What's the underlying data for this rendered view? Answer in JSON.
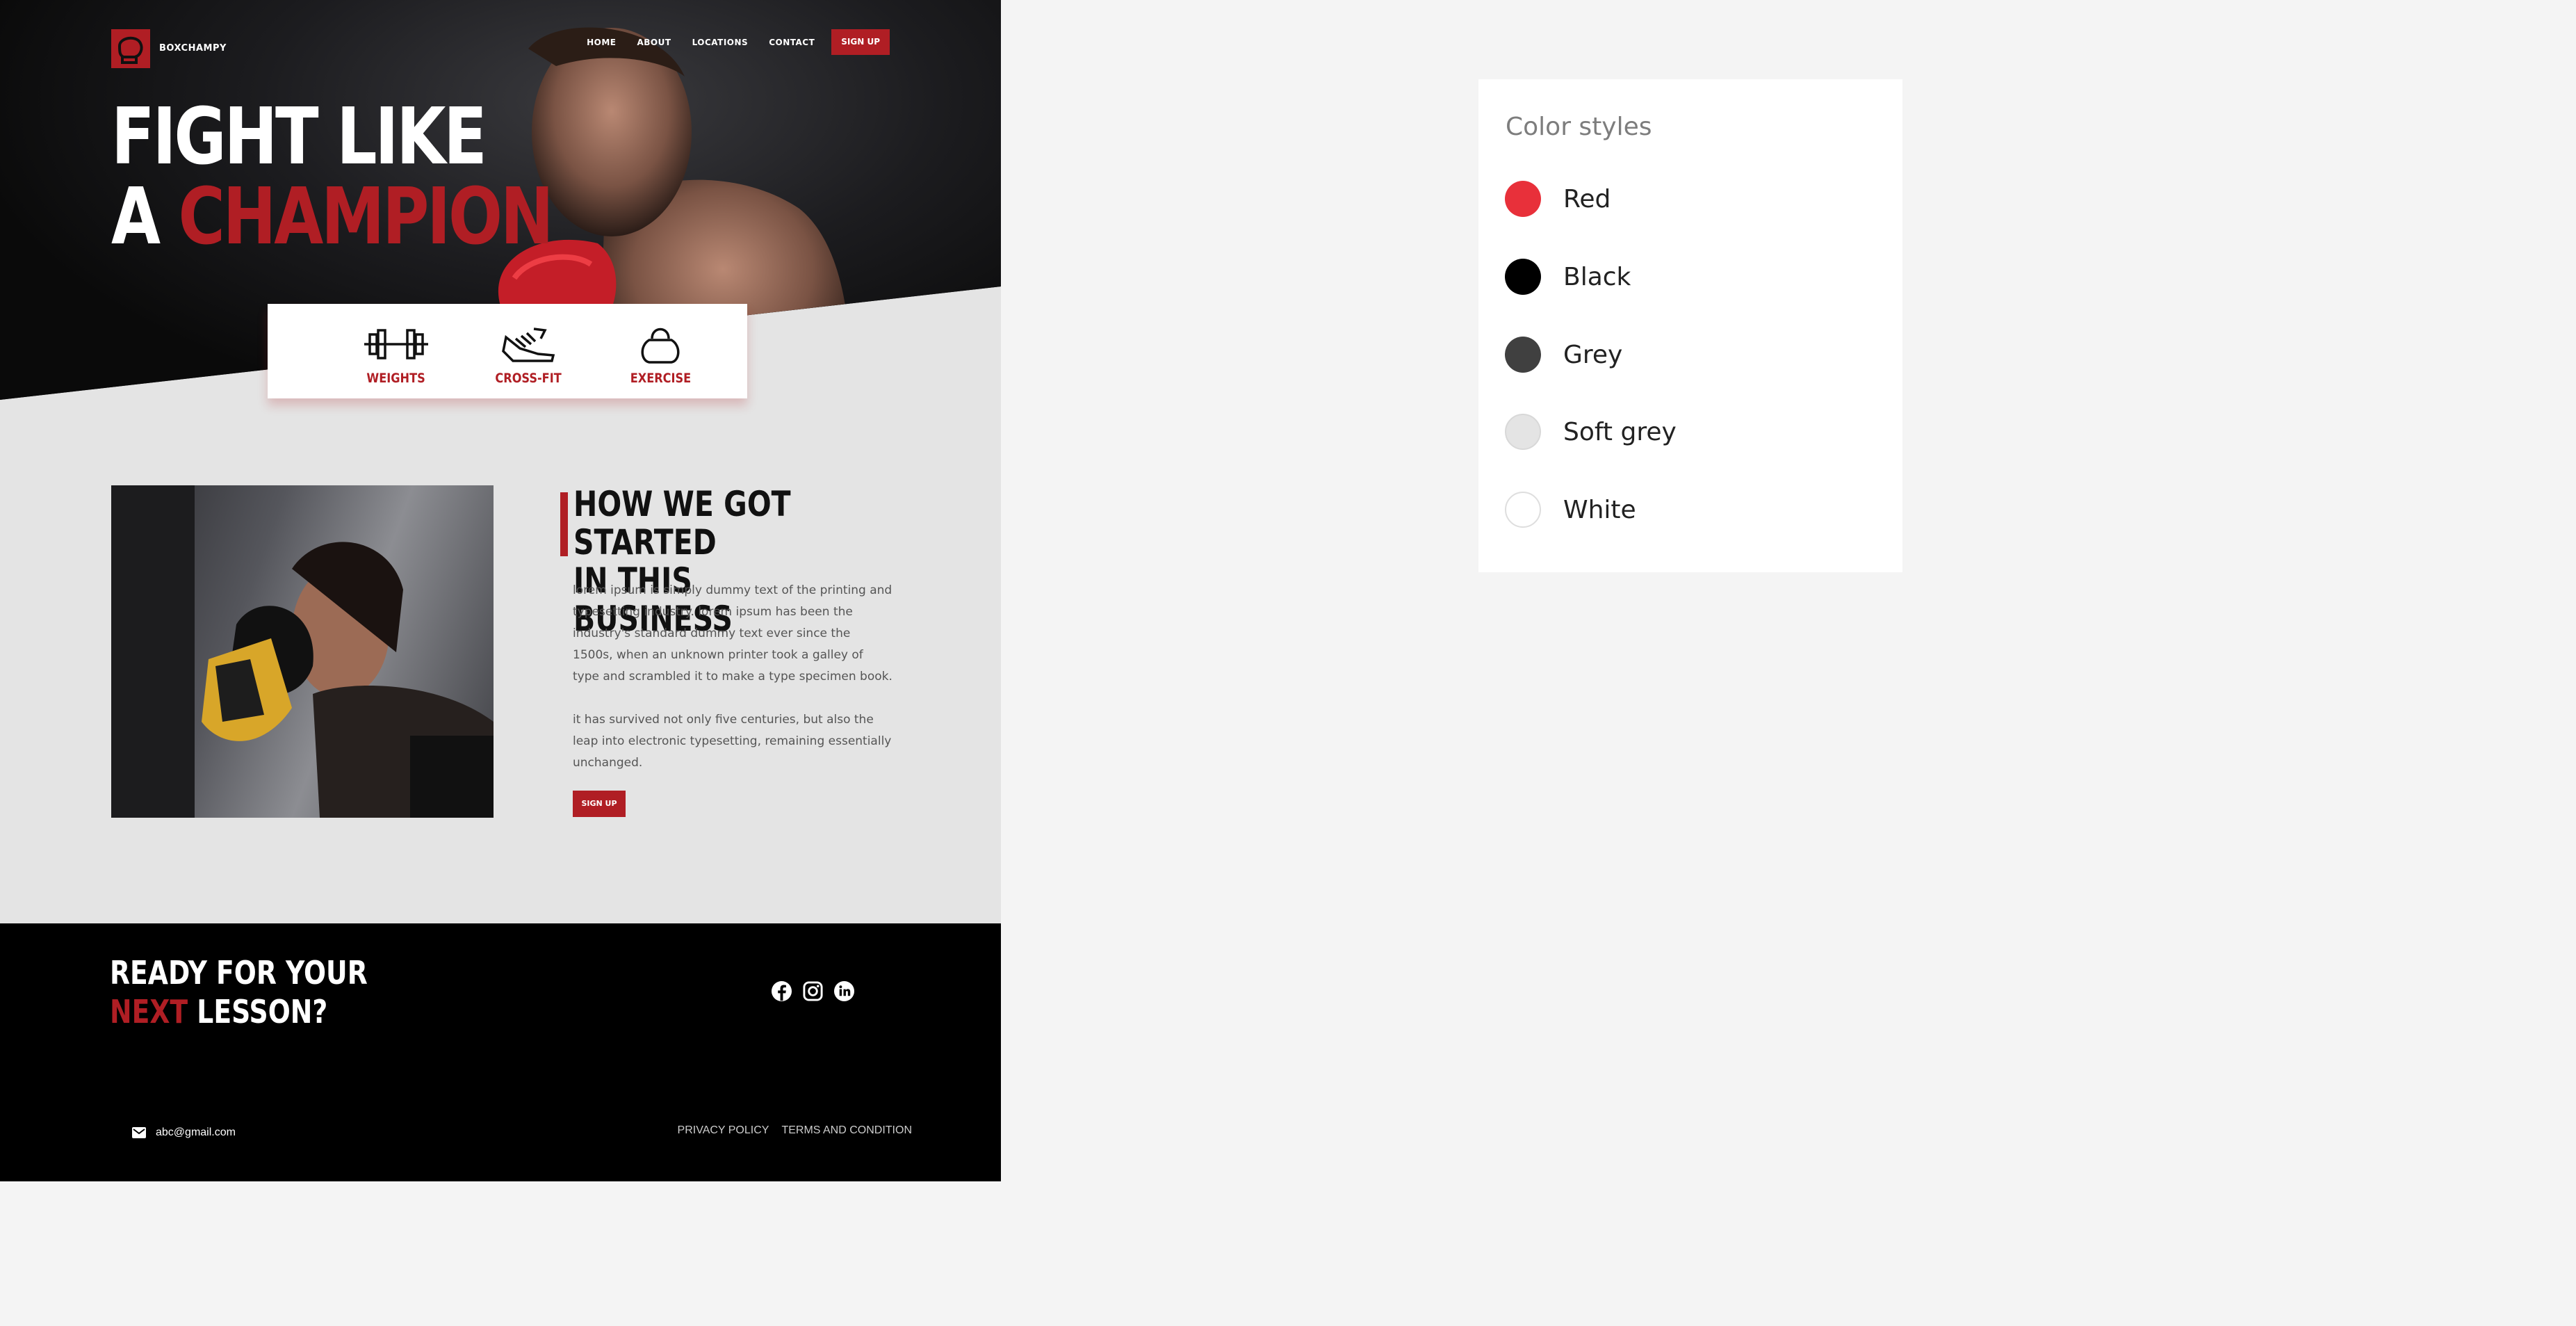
{
  "colors": {
    "red": "#b01e24",
    "black": "#000000",
    "bg_grey": "#e4e4e4",
    "page_bg": "#f4f4f4"
  },
  "nav": {
    "brand": "BOXCHAMPY",
    "logo_icon": "boxing-glove-icon",
    "links": [
      "HOME",
      "ABOUT",
      "LOCATIONS",
      "CONTACT"
    ],
    "signup": "SIGN UP"
  },
  "hero": {
    "line1": "FIGHT LIKE",
    "line2_prefix": "A ",
    "line2_highlight": "CHAMPION"
  },
  "features": [
    {
      "label": "WEIGHTS",
      "icon": "barbell-icon"
    },
    {
      "label": "CROSS-FIT",
      "icon": "sneaker-icon"
    },
    {
      "label": "EXERCISE",
      "icon": "kettlebell-icon"
    }
  ],
  "about": {
    "title_line1": "HOW WE GOT STARTED",
    "title_line2": "IN THIS BUSINESS",
    "paragraph1": "lorem ipsum is simply dummy text of the printing and typesetting industry. lorem ipsum has been the industry's standard dummy text ever since the 1500s, when an unknown printer took a galley of type and scrambled it to make a type specimen book.",
    "paragraph2": "it has survived not only five centuries, but also the leap into electronic typesetting, remaining essentially unchanged.",
    "button": "SIGN UP"
  },
  "footer": {
    "cta_line1": "READY FOR YOUR",
    "cta_highlight": "NEXT",
    "cta_rest": " LESSON?",
    "socials": [
      "facebook-icon",
      "instagram-icon",
      "linkedin-icon"
    ],
    "email": "abc@gmail.com",
    "privacy": "PRIVACY POLICY",
    "terms": "TERMS AND CONDITION"
  },
  "color_styles": {
    "title": "Color styles",
    "items": [
      {
        "name": "Red",
        "hex": "#e8303a"
      },
      {
        "name": "Black",
        "hex": "#000000"
      },
      {
        "name": "Grey",
        "hex": "#404040"
      },
      {
        "name": "Soft grey",
        "hex": "#e4e4e4"
      },
      {
        "name": "White",
        "hex": "#ffffff"
      }
    ]
  }
}
